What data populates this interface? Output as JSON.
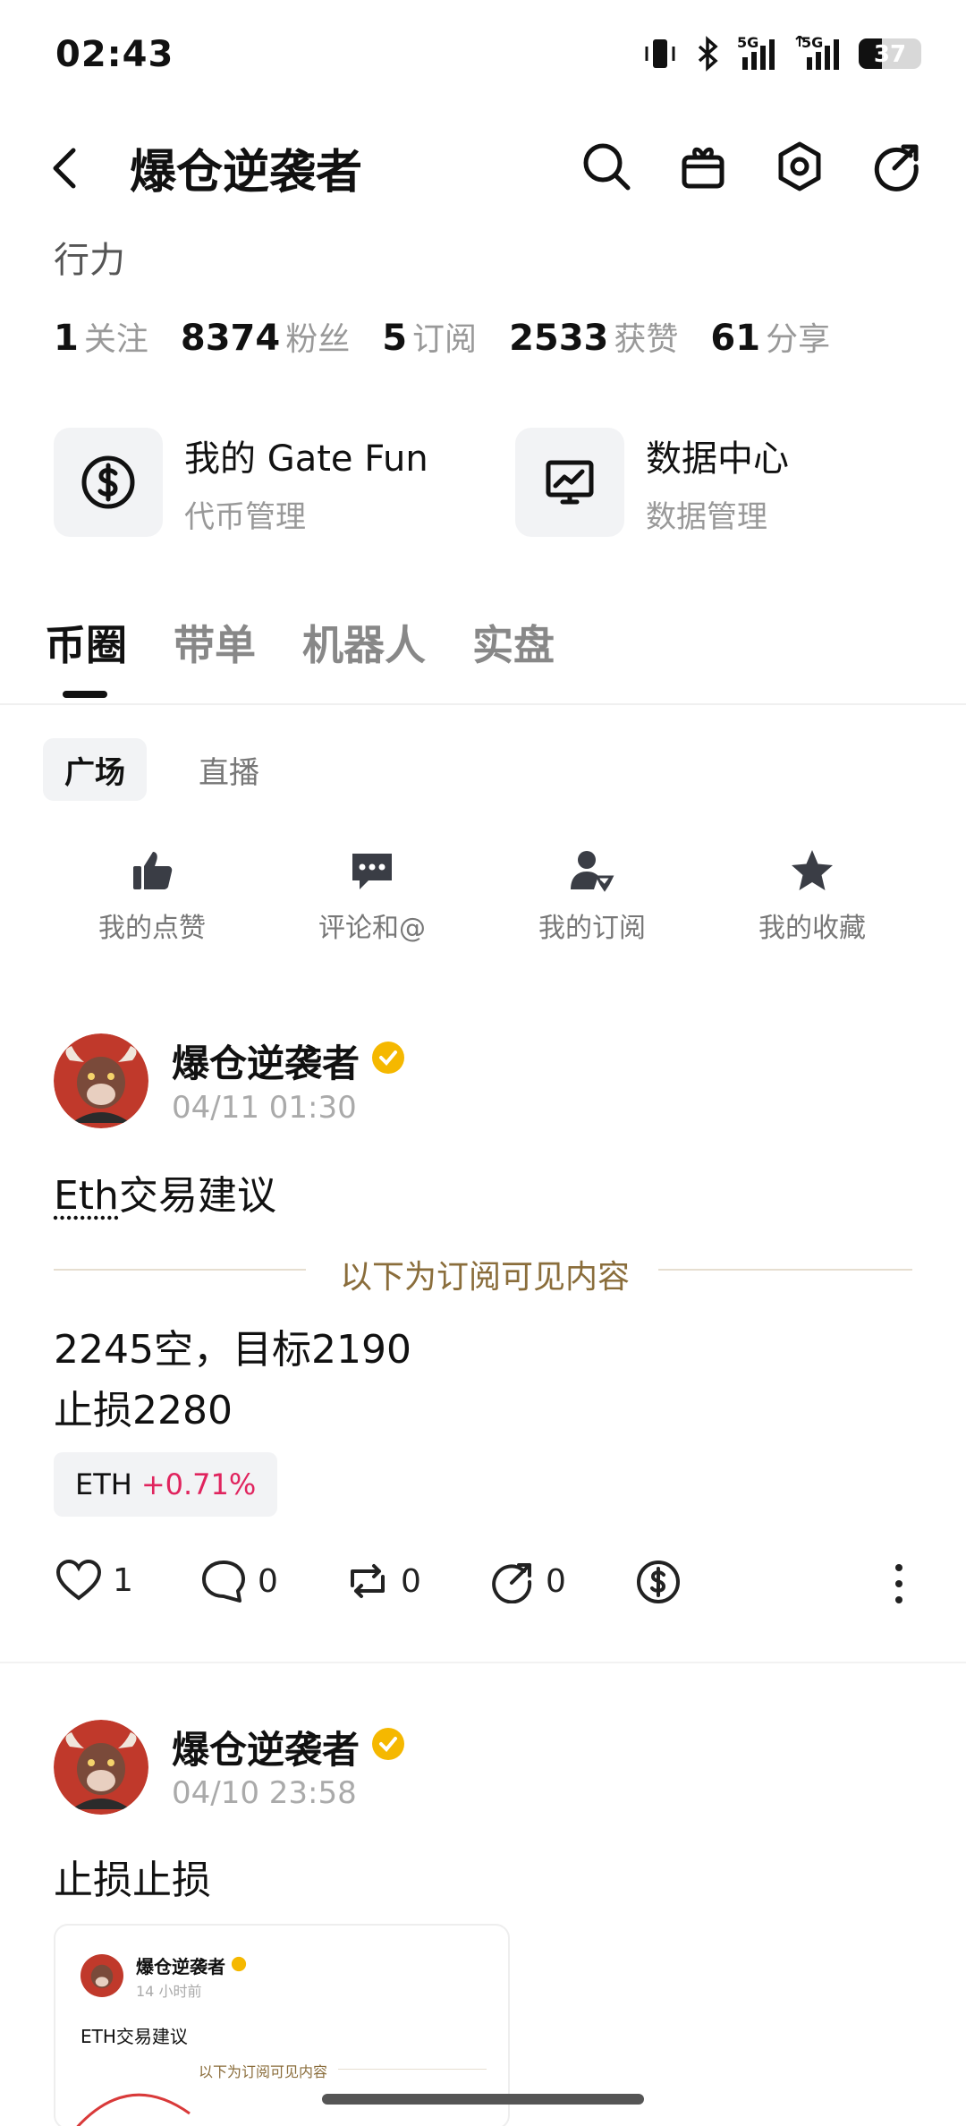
{
  "status_bar": {
    "time": "02:43",
    "battery": "37",
    "battery_level": 0.37,
    "signal_1_label": "5G",
    "signal_2_label": "5G"
  },
  "header": {
    "title": "爆仓逆袭者"
  },
  "profile": {
    "bio": "行力",
    "stats": [
      {
        "value": "1",
        "label": "关注"
      },
      {
        "value": "8374",
        "label": "粉丝"
      },
      {
        "value": "5",
        "label": "订阅"
      },
      {
        "value": "2533",
        "label": "获赞"
      },
      {
        "value": "61",
        "label": "分享"
      }
    ]
  },
  "cards": [
    {
      "title": "我的 Gate Fun",
      "subtitle": "代币管理",
      "icon": "dollar-coin-icon"
    },
    {
      "title": "数据中心",
      "subtitle": "数据管理",
      "icon": "monitor-chart-icon"
    }
  ],
  "tabs": [
    {
      "label": "币圈",
      "active": true
    },
    {
      "label": "带单",
      "active": false
    },
    {
      "label": "机器人",
      "active": false
    },
    {
      "label": "实盘",
      "active": false
    }
  ],
  "subtabs": [
    {
      "label": "广场",
      "active": true
    },
    {
      "label": "直播",
      "active": false
    }
  ],
  "quick_actions": [
    {
      "label": "我的点赞",
      "icon": "thumbs-up-icon"
    },
    {
      "label": "评论和@",
      "icon": "comment-icon"
    },
    {
      "label": "我的订阅",
      "icon": "subscribe-user-icon"
    },
    {
      "label": "我的收藏",
      "icon": "star-icon"
    }
  ],
  "posts": [
    {
      "author": "爆仓逆袭者",
      "time": "04/11 01:30",
      "text_link": "Eth",
      "text_rest": "交易建议",
      "subscription_label": "以下为订阅可见内容",
      "body_line_1": "2245空，目标2190",
      "body_line_2": "止损2280",
      "tag_symbol": "ETH",
      "tag_change": "+0.71%",
      "likes": "1",
      "comments": "0",
      "reposts": "0",
      "shares": "0"
    },
    {
      "author": "爆仓逆袭者",
      "time": "04/10 23:58",
      "text": "止损止损",
      "embed": {
        "author": "爆仓逆袭者",
        "time": "14 小时前",
        "text": "ETH交易建议",
        "subscription_label": "以下为订阅可见内容"
      }
    }
  ],
  "colors": {
    "accent_gold": "#f5b800",
    "up_red": "#e0245e",
    "subscription_text": "#8a6d3b"
  }
}
